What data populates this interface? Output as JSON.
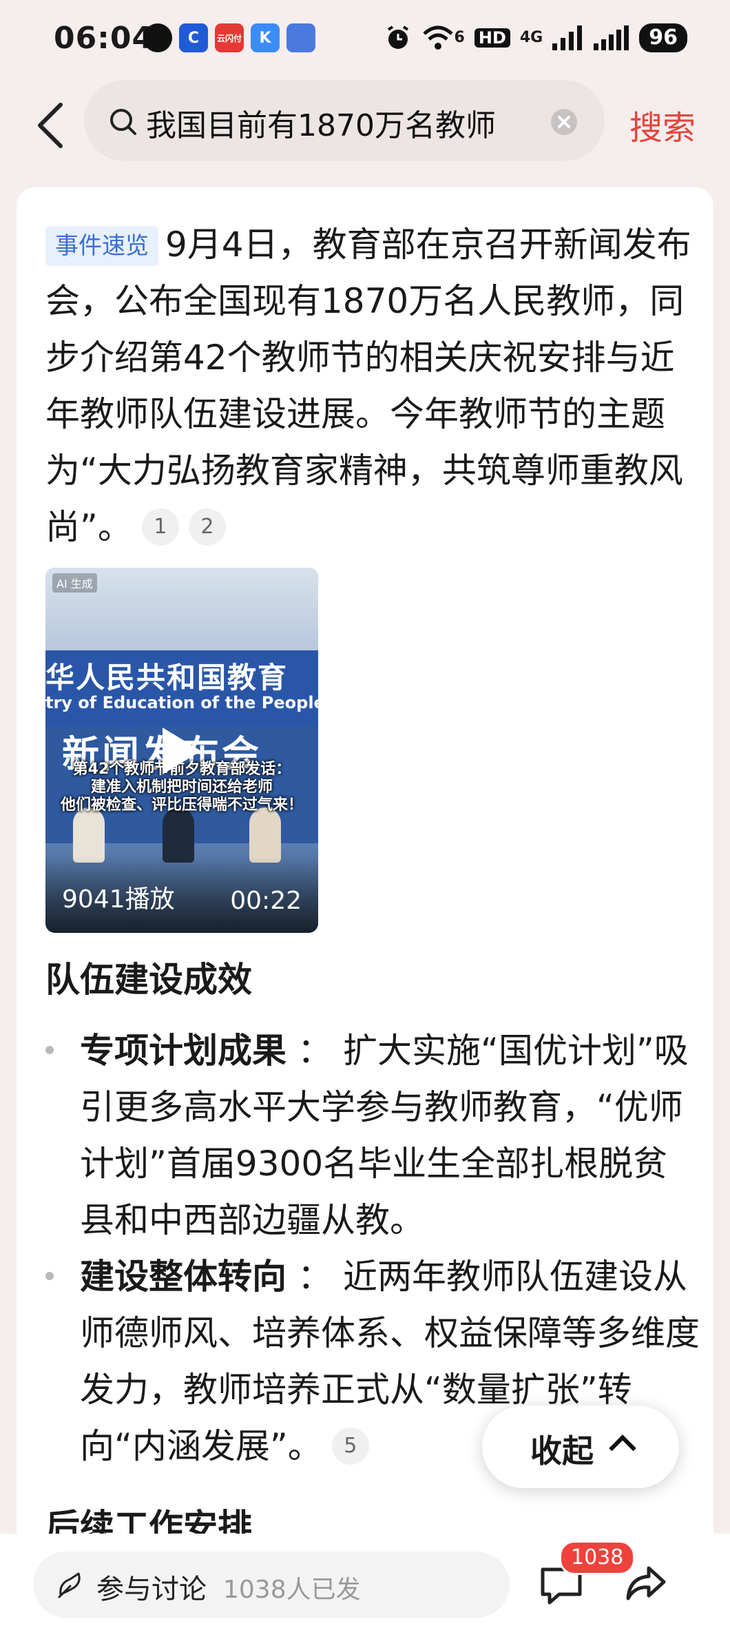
{
  "status_bar": {
    "time": "06:04",
    "apps": [
      {
        "icon": "message-icon",
        "label": "",
        "color": "#111111"
      },
      {
        "icon": "app-c-icon",
        "label": "C",
        "color": "#1f5bd6"
      },
      {
        "icon": "cloud-pay-icon",
        "label": "云闪付",
        "color": "#e53935"
      },
      {
        "icon": "k-app-icon",
        "label": "K",
        "color": "#3b8cf7"
      },
      {
        "icon": "chart-app-icon",
        "label": "",
        "color": "#4a7ae0"
      }
    ],
    "signal_5g": "6",
    "hd": "HD",
    "network": "4G",
    "battery": "96"
  },
  "search": {
    "query": "我国目前有1870万名教师",
    "button": "搜索"
  },
  "article": {
    "tag": "事件速览",
    "intro": "9月4日，教育部在京召开新闻发布会，公布全国现有1870万名人民教师，同步介绍第42个教师节的相关庆祝安排与近年教师队伍建设进展。今年教师节的主题为“大力弘扬教育家精神，共筑尊师重教风尚”。",
    "citations": [
      "1",
      "2"
    ],
    "video": {
      "ai_label": "AI 生成",
      "backdrop_line1": "华人民共和国教育",
      "backdrop_line2": "try of Education of the People's Republic of",
      "backdrop_line3": "新闻发布会",
      "caption_line1": "第42个教师节前夕教育部发话：",
      "caption_line2": "建准入机制把时间还给老师",
      "caption_line3": "他们被检查、评比压得喘不过气来！",
      "plays": "9041播放",
      "duration": "00:22"
    },
    "section1_title": "队伍建设成效",
    "items": [
      {
        "bold": "专项计划成果",
        "sep": "：",
        "text": "扩大实施“国优计划”吸引更多高水平大学参与教师教育，“优师计划”首届9300名毕业生全部扎根脱贫县和中西部边疆从教。",
        "cite": ""
      },
      {
        "bold": "建设整体转向",
        "sep": "：",
        "text": "近两年教师队伍建设从师德师风、培养体系、权益保障等多维度发力，教师培养正式从“数量扩张”转向“内涵发展”。",
        "cite": "5"
      }
    ],
    "section2_title": "后续工作安排",
    "collapse": "收起"
  },
  "bottom_bar": {
    "discuss_label": "参与讨论",
    "discuss_count": "1038人已发",
    "comment_badge": "1038"
  },
  "colors": {
    "accent": "#e0463c",
    "tag_bg": "#e8f0fb",
    "tag_text": "#3c6fd1",
    "badge": "#f0423c"
  }
}
